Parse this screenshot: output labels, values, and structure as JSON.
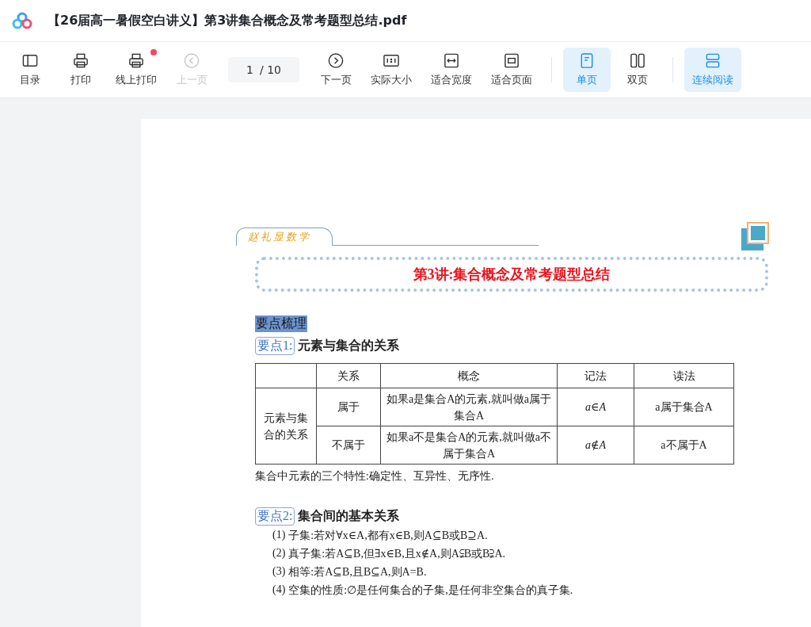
{
  "window": {
    "title": "【26届高一暑假空白讲义】第3讲集合概念及常考题型总结.pdf"
  },
  "toolbar": {
    "items": [
      {
        "kind": "button",
        "label": "目录",
        "selected": false,
        "disabled": false,
        "notification": false
      },
      {
        "kind": "button",
        "label": "打印",
        "selected": false,
        "disabled": false,
        "notification": false
      },
      {
        "kind": "button",
        "label": "线上打印",
        "selected": false,
        "disabled": false,
        "notification": true
      },
      {
        "kind": "button",
        "label": "上一页",
        "selected": false,
        "disabled": true,
        "notification": false
      },
      {
        "kind": "pager",
        "value": "1",
        "total": "/ 10"
      },
      {
        "kind": "button",
        "label": "下一页",
        "selected": false,
        "disabled": false,
        "notification": false
      },
      {
        "kind": "button",
        "label": "实际大小",
        "selected": false,
        "disabled": false,
        "notification": false
      },
      {
        "kind": "button",
        "label": "适合宽度",
        "selected": false,
        "disabled": false,
        "notification": false
      },
      {
        "kind": "button",
        "label": "适合页面",
        "selected": false,
        "disabled": false,
        "notification": false
      },
      {
        "kind": "separator"
      },
      {
        "kind": "button",
        "label": "单页",
        "selected": true,
        "disabled": false,
        "notification": false
      },
      {
        "kind": "button",
        "label": "双页",
        "selected": false,
        "disabled": false,
        "notification": false
      },
      {
        "kind": "separator"
      },
      {
        "kind": "button",
        "label": "连续阅读",
        "selected": true,
        "disabled": false,
        "notification": false
      }
    ]
  },
  "document": {
    "brand": "赵礼显数学",
    "title": "第3讲:集合概念及常考题型总结",
    "section": "要点梳理",
    "point1": {
      "tag": "要点1:",
      "heading": "元素与集合的关系",
      "table": {
        "columns": [
          "关系",
          "概念",
          "记法",
          "读法"
        ],
        "group": "元素与集合的关系",
        "rows": [
          {
            "relation": "属于",
            "concept": "如果a是集合A的元素,就叫做a属于集合A",
            "notation": "a∈A",
            "reading": "a属于集合A"
          },
          {
            "relation": "不属于",
            "concept": "如果a不是集合A的元素,就叫做a不属于集合A",
            "notation": "a∉A",
            "reading": "a不属于A"
          }
        ]
      },
      "note": "集合中元素的三个特性:确定性、互异性、无序性."
    },
    "point2": {
      "tag": "要点2:",
      "heading": "集合间的基本关系",
      "items": [
        {
          "number": "(1)",
          "text": "子集:若对∀x∈A,都有x∈B,则A⊆B或B⊇A."
        },
        {
          "number": "(2)",
          "text": "真子集:若A⊆B,但∃x∈B,且x∉A,则A⫋B或B⫌A."
        },
        {
          "number": "(3)",
          "text": "相等:若A⊆B,且B⊆A,则A=B."
        },
        {
          "number": "(4)",
          "text": "空集的性质:∅是任何集合的子集,是任何非空集合的真子集."
        }
      ]
    }
  }
}
